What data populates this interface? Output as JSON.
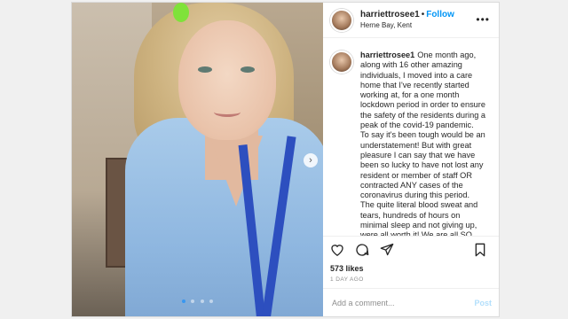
{
  "header": {
    "username": "harriettrosee1",
    "separator": "•",
    "follow_label": "Follow",
    "location": "Herne Bay, Kent",
    "more_label": "•••"
  },
  "caption": {
    "username": "harriettrosee1",
    "paragraphs": [
      "One month ago, along with 16 other amazing individuals, I moved into a care home that I've recently started working at, for a one month lockdown period in order to ensure the safety of the residents during a peak of the covid-19 pandemic.",
      "To say it's been tough would be an understatement! But with great pleasure I can say that we have been so lucky to have not lost any resident or member of staff OR contracted ANY cases of the coronavirus during this period.",
      "The quite literal blood sweat and tears, hundreds of hours on minimal sleep and not giving up, were all worth it! We are all SO blessed and we feel so proud of our huge"
    ]
  },
  "carousel": {
    "next_label": "›",
    "dot_count": 4,
    "active_index": 0
  },
  "icons": {
    "like": "heart-icon",
    "comment": "comment-icon",
    "share": "share-icon",
    "save": "bookmark-icon"
  },
  "likes": "573 likes",
  "timestamp": "1 DAY AGO",
  "comment": {
    "placeholder": "Add a comment...",
    "post_label": "Post"
  },
  "colors": {
    "link": "#0095f6",
    "post_disabled": "#b2dffc",
    "border": "#dbdbdb"
  }
}
